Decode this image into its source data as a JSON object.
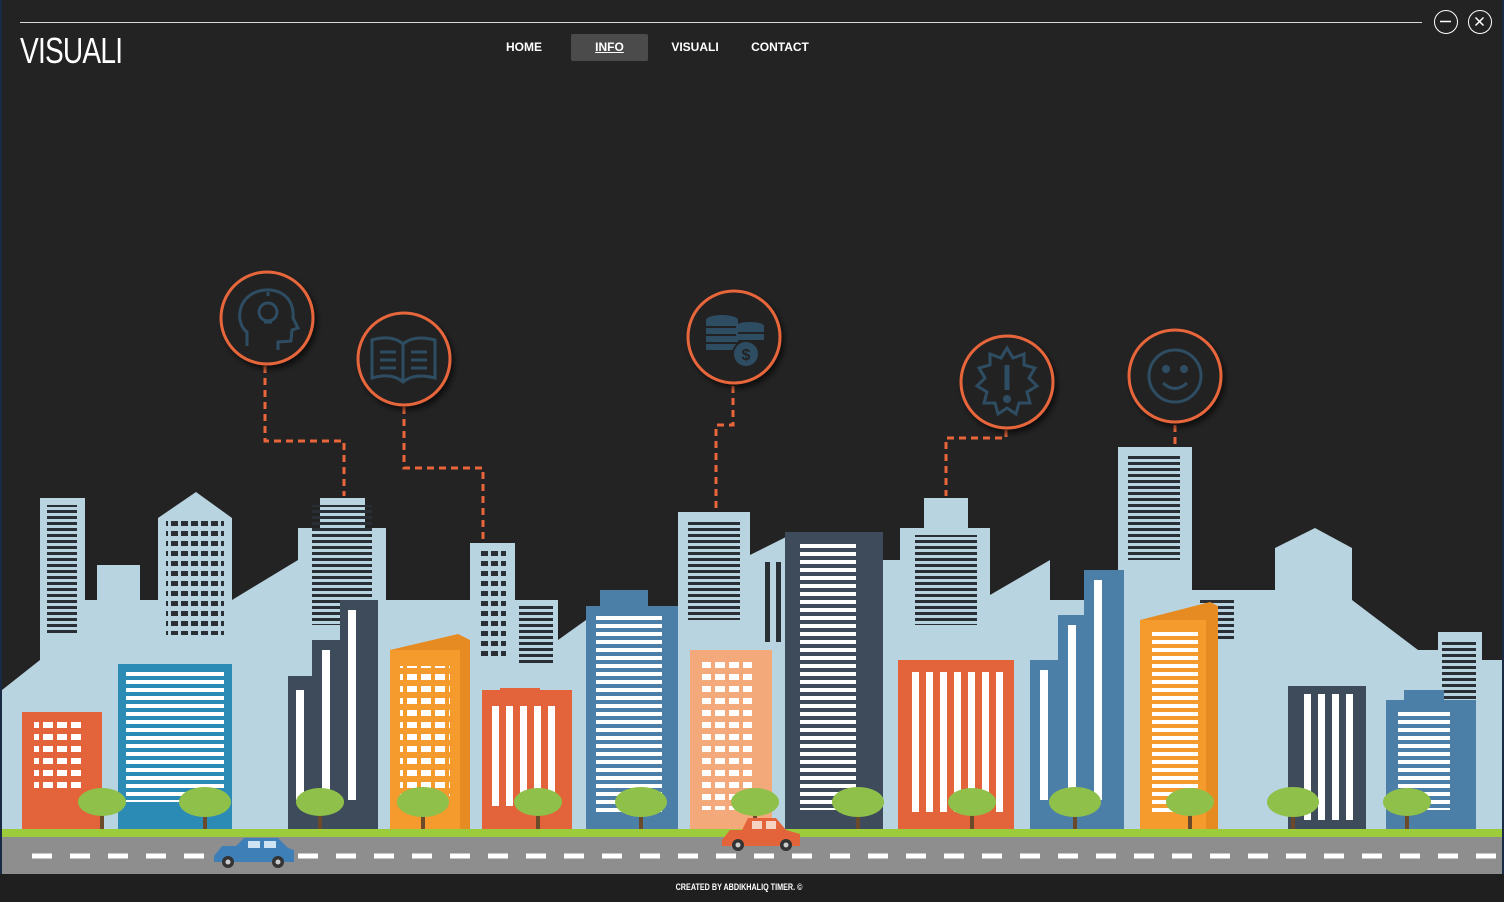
{
  "app": {
    "logo": "VISUALI"
  },
  "nav": {
    "items": [
      {
        "label": "HOME",
        "active": false
      },
      {
        "label": "INFO",
        "active": true
      },
      {
        "label": "VISUALI",
        "active": false
      },
      {
        "label": "CONTACT",
        "active": false
      }
    ]
  },
  "window_controls": {
    "minimize_icon": "minimize-circle-icon",
    "close_icon": "close-circle-icon"
  },
  "info_icons": [
    {
      "name": "head-lightbulb-icon"
    },
    {
      "name": "open-book-icon"
    },
    {
      "name": "coins-dollar-icon"
    },
    {
      "name": "alert-badge-icon"
    },
    {
      "name": "smiley-face-icon"
    }
  ],
  "footer": {
    "credit": "CREATED BY ABDIKHALIQ TIMER. ©"
  },
  "colors": {
    "background": "#232323",
    "accent_ring": "#e8663a",
    "icon_fill": "#2f4d63",
    "sky_buildings": "#b9d4e1",
    "grass": "#9ccc3c",
    "road": "#8e8e8e"
  }
}
